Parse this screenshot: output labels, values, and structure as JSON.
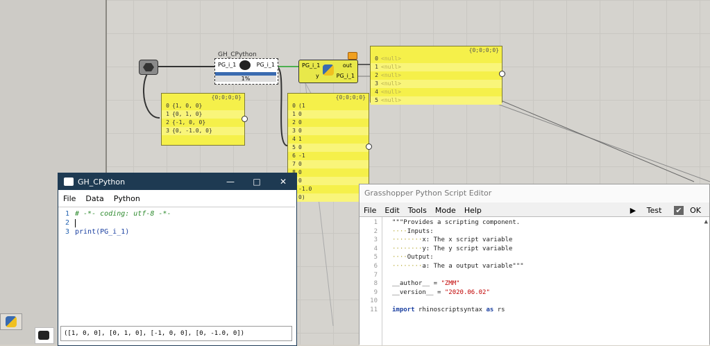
{
  "canvas": {
    "component_main": {
      "title": "GH_CPython",
      "input": "PG_i_1",
      "output": "PG_i_1",
      "progress": "1%"
    },
    "component_script": {
      "in_x": "PG_i_1",
      "in_y": "y",
      "out_1": "out",
      "out_2": "PG_i_1"
    },
    "panel_input": {
      "header": "{0;0;0;0}",
      "rows": [
        {
          "idx": "0",
          "val": "{1, 0, 0}"
        },
        {
          "idx": "1",
          "val": "{0, 1, 0}"
        },
        {
          "idx": "2",
          "val": "{-1, 0, 0}"
        },
        {
          "idx": "3",
          "val": "{0, -1.0, 0}"
        }
      ]
    },
    "panel_output": {
      "header": "{0;0;0;0}",
      "rows": [
        {
          "idx": "0",
          "val": "(1"
        },
        {
          "idx": "1",
          "val": "0"
        },
        {
          "idx": "2",
          "val": "0"
        },
        {
          "idx": "3",
          "val": "0"
        },
        {
          "idx": "4",
          "val": "1"
        },
        {
          "idx": "5",
          "val": "0"
        },
        {
          "idx": "6",
          "val": "-1"
        },
        {
          "idx": "7",
          "val": "0"
        },
        {
          "idx": "8",
          "val": "0"
        },
        {
          "idx": "9",
          "val": "0"
        },
        {
          "idx": "",
          "val": "-1.0"
        },
        {
          "idx": "",
          "val": "0)"
        }
      ]
    },
    "panel_null": {
      "header": "{0;0;0;0}",
      "rows": [
        {
          "idx": "0",
          "val": "<null>"
        },
        {
          "idx": "1",
          "val": "<null>"
        },
        {
          "idx": "2",
          "val": "<null>"
        },
        {
          "idx": "3",
          "val": "<null>"
        },
        {
          "idx": "4",
          "val": "<null>"
        },
        {
          "idx": "5",
          "val": "<null>"
        }
      ]
    }
  },
  "gh_cpython_window": {
    "title": "GH_CPython",
    "menu": [
      "File",
      "Data",
      "Python"
    ],
    "lines": [
      {
        "n": "1",
        "text": "# -*- coding: utf-8 -*-"
      },
      {
        "n": "2",
        "text": ""
      },
      {
        "n": "3",
        "text": "print(PG_i_1)"
      }
    ],
    "console": "([1, 0, 0], [0, 1, 0], [-1, 0, 0], [0, -1.0, 0])"
  },
  "script_editor": {
    "title": "Grasshopper Python Script Editor",
    "menu": [
      "File",
      "Edit",
      "Tools",
      "Mode",
      "Help"
    ],
    "test_label": "Test",
    "ok_label": "OK",
    "lines": [
      {
        "n": "1",
        "text": "\"\"\"Provides a scripting component."
      },
      {
        "n": "2",
        "text": "Inputs:"
      },
      {
        "n": "3",
        "text": "x: The x script variable"
      },
      {
        "n": "4",
        "text": "y: The y script variable"
      },
      {
        "n": "5",
        "text": "Output:"
      },
      {
        "n": "6",
        "text": "a: The a output variable\"\"\""
      },
      {
        "n": "7",
        "text": ""
      },
      {
        "n": "8",
        "text": "__author__ = "
      },
      {
        "n": "9",
        "text": "__version__ = "
      },
      {
        "n": "10",
        "text": ""
      },
      {
        "n": "11",
        "text": "import"
      }
    ],
    "author_value": "\"ZMM\"",
    "version_value": "\"2020.06.02\"",
    "import_module": "rhinoscriptsyntax",
    "import_as": "as",
    "import_alias": "rs"
  },
  "colors": {
    "panel": "#f5f04a",
    "window_title": "#1e3a52",
    "canvas": "#d5d3ce"
  }
}
